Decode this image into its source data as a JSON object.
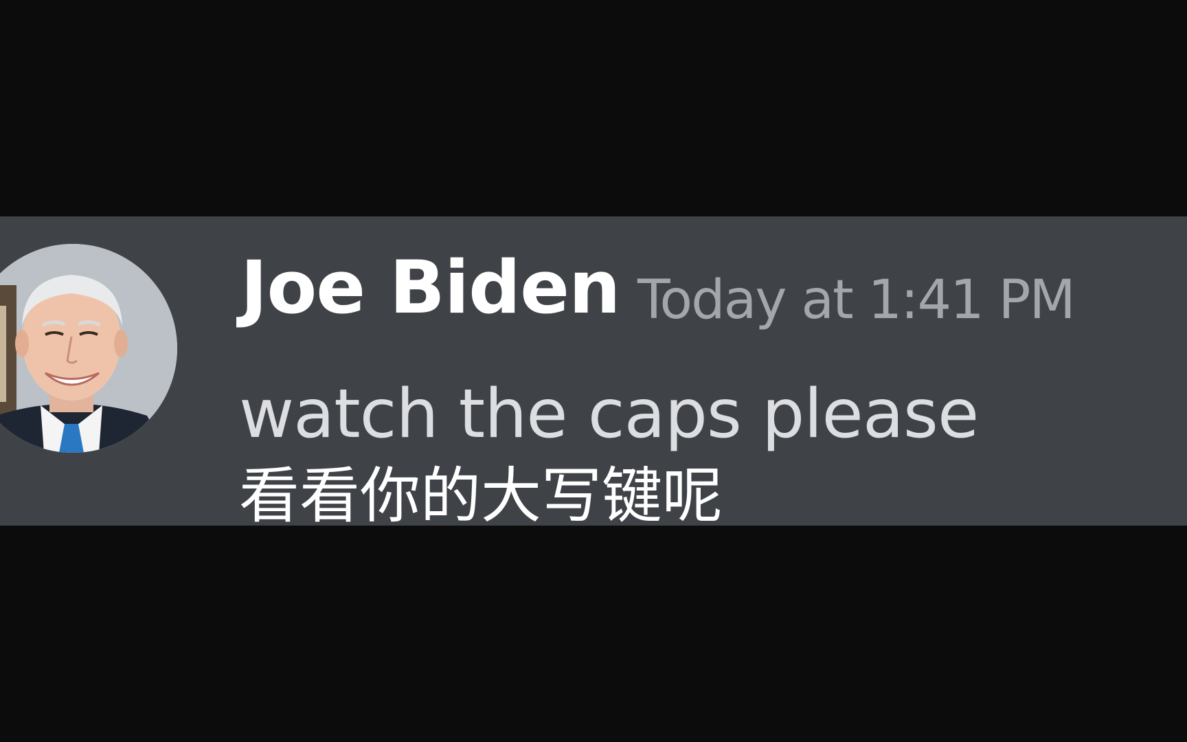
{
  "message": {
    "author": "Joe Biden",
    "timestamp": "Today at 1:41 PM",
    "text": "watch the caps please"
  },
  "subtitle": {
    "text": "看看你的大写键呢"
  },
  "avatar": {
    "icon": "user-avatar-photo"
  },
  "colors": {
    "background": "#0c0c0d",
    "message_band": "#3f4347",
    "author": "#ffffff",
    "timestamp": "#a3a6aa",
    "message_text": "#dcdee1",
    "subtitle": "#ffffff"
  }
}
